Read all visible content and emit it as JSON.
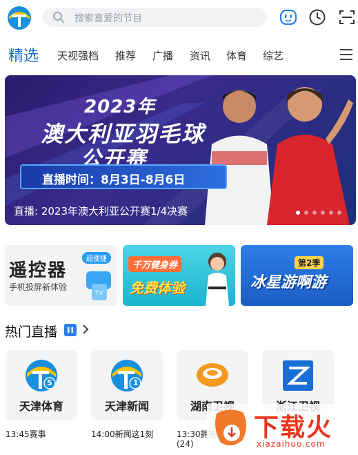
{
  "search": {
    "placeholder": "搜索喜爱的节目"
  },
  "icons": {
    "logo": "tianjin-tv-logo",
    "search": "search-icon",
    "robot": "robot-icon",
    "history": "clock-icon",
    "scan": "scan-icon",
    "menu": "menu-icon"
  },
  "tabs": [
    {
      "label": "精选",
      "active": true
    },
    {
      "label": "天视强档"
    },
    {
      "label": "推荐"
    },
    {
      "label": "广播"
    },
    {
      "label": "资讯"
    },
    {
      "label": "体育"
    },
    {
      "label": "综艺"
    }
  ],
  "banner": {
    "year": "2023年",
    "title_line1": "澳大利亚羽毛球",
    "title_line2": "公开赛",
    "time_text": "直播时间：8月3日-8月6日",
    "caption": "直播: 2023年澳大利亚公开赛1/4决赛",
    "slide_count": 6,
    "active_slide": 0
  },
  "promos": [
    {
      "title": "遥控器",
      "subtitle": "手机投屏新体验",
      "badge": "超便捷"
    },
    {
      "top": "千万健身券",
      "main": "免费体验"
    },
    {
      "title": "冰星游啊游",
      "season": "第2季"
    }
  ],
  "hot": {
    "title": "热门直播"
  },
  "channels": [
    {
      "name": "天津体育",
      "number": "5",
      "program": "13:45赛事"
    },
    {
      "name": "天津新闻",
      "number": "1",
      "program": "14:00新闻这1刻"
    },
    {
      "name": "湖南卫视",
      "program": "13:30拥抱"
    },
    {
      "name": "浙江卫视",
      "program": ""
    }
  ],
  "extra_program_line": "(24)",
  "watermark": {
    "text": "下载火",
    "url": "xiazaihuo.com"
  },
  "colors": {
    "accent": "#1f6fd8",
    "tj_yellow": "#f5c400",
    "tj_blue": "#1a8fe0"
  }
}
